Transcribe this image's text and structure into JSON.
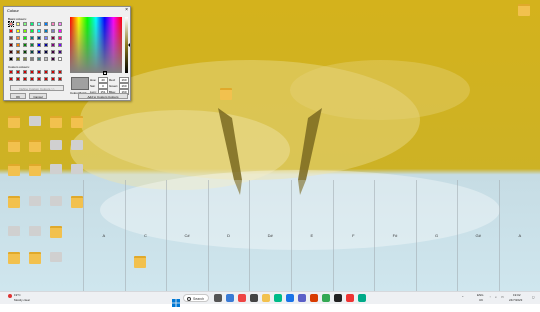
{
  "dialog": {
    "title": "Colour",
    "close_glyph": "×",
    "basic_colours_label": "Basic colours:",
    "custom_colours_label": "Custom colours:",
    "define_label": "Define Custom Colours >>",
    "ok_label": "OK",
    "cancel_label": "Cancel",
    "add_label": "Add to Custom Colours",
    "colour_solid_label": "Colour|Solid",
    "fields": {
      "hue_label": "Hue:",
      "hue": "40",
      "sat_label": "Sat:",
      "sat": "0",
      "lum_label": "Lum:",
      "lum": "151",
      "red_label": "Red:",
      "red": "160",
      "green_label": "Green:",
      "green": "160",
      "blue_label": "Blue:",
      "blue": "160"
    },
    "basic_colours": [
      "#ff8080",
      "#ffff80",
      "#80ff80",
      "#00ff80",
      "#80ffff",
      "#0080ff",
      "#ff80c0",
      "#ff80ff",
      "#ff0000",
      "#ffff00",
      "#80ff00",
      "#00ff40",
      "#00ffff",
      "#0080c0",
      "#8080c0",
      "#ff00ff",
      "#804040",
      "#ff8040",
      "#00ff00",
      "#008080",
      "#004080",
      "#8080ff",
      "#800040",
      "#ff0080",
      "#800000",
      "#ff8000",
      "#008000",
      "#008040",
      "#0000ff",
      "#0000a0",
      "#800080",
      "#8000ff",
      "#400000",
      "#804000",
      "#004000",
      "#004040",
      "#000080",
      "#000040",
      "#400040",
      "#400080",
      "#000000",
      "#808000",
      "#808040",
      "#808080",
      "#408080",
      "#c0c0c0",
      "#400040",
      "#ffffff"
    ],
    "custom_colours": [
      "#cc0000",
      "#cc0000",
      "#cc0000",
      "#cc0000",
      "#cc0000",
      "#cc0000",
      "#cc0000",
      "#cc0000",
      "#cc0000",
      "#cc0000",
      "#cc0000",
      "#cc0000",
      "#cc0000",
      "#cc0000",
      "#cc0000",
      "#cc0000"
    ],
    "preview_colour": "#a0a0a0"
  },
  "desktop": {
    "keyboard_labels": [
      "A",
      "C",
      "C#",
      "D",
      "D#",
      "E",
      "F",
      "F#",
      "G",
      "G#",
      "A"
    ],
    "icon_names": [
      "folder",
      "app",
      "folder",
      "folder",
      "folder",
      "folder",
      "app",
      "app",
      "folder",
      "folder",
      "app",
      "app",
      "folder",
      "app",
      "app",
      "folder",
      "app",
      "app",
      "folder",
      "folder"
    ]
  },
  "taskbar": {
    "search_label": "Search",
    "weather_temp": "19°C",
    "weather_desc": "Mostly clear",
    "lang": "ENG",
    "region": "UK",
    "time": "19:02",
    "date": "24/7/2023"
  },
  "colors": {
    "accent": "#0067c0",
    "wallpaper_top": "#d4b21c",
    "wallpaper_bottom": "#cfe6ee"
  }
}
